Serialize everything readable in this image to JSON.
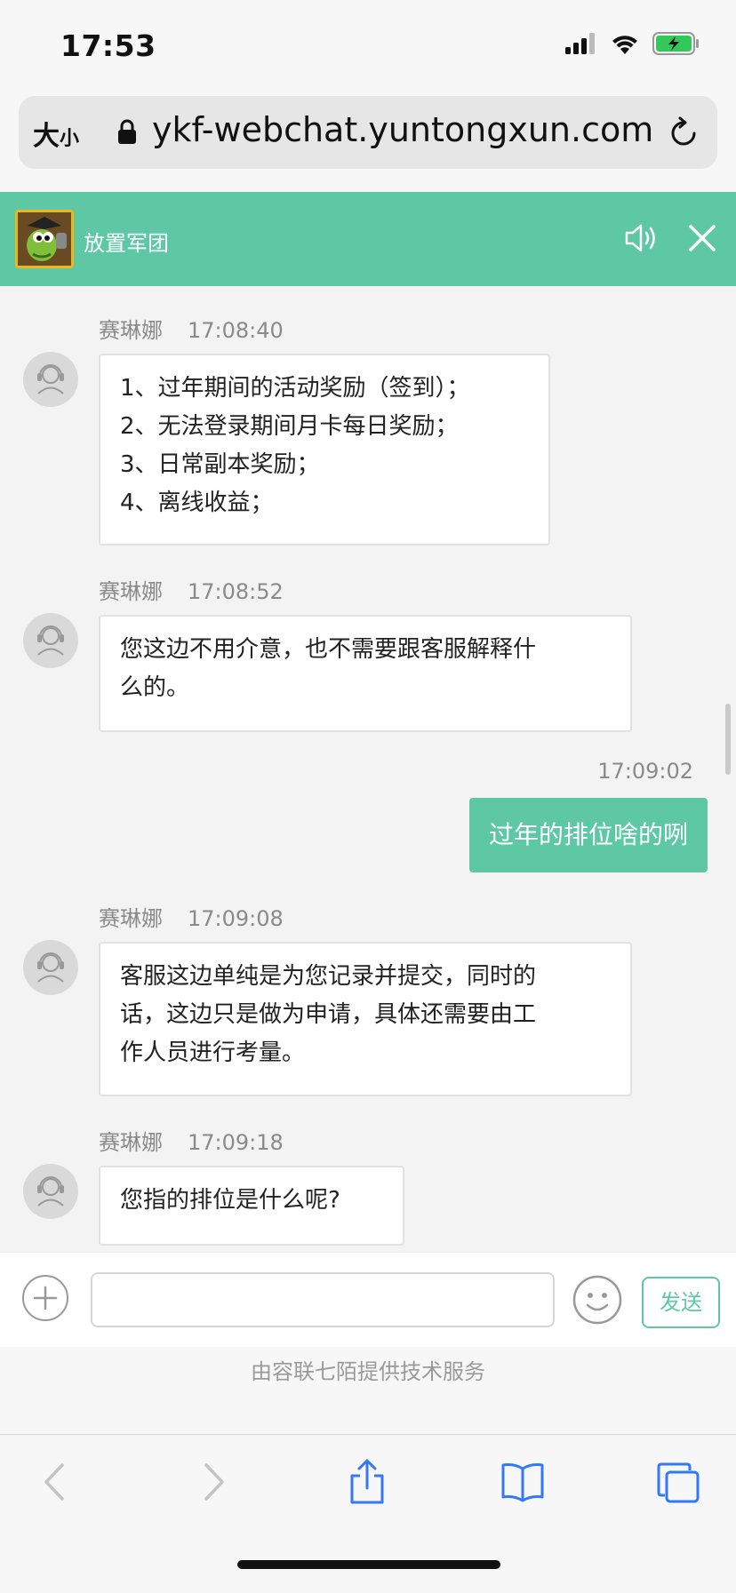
{
  "status_bar": {
    "time": "17:53"
  },
  "browser": {
    "text_size_label": "大",
    "text_size_small": "小",
    "url": "ykf-webchat.yuntongxun.com"
  },
  "chat": {
    "title": "放置军团",
    "messages": [
      {
        "sender": "赛琳娜",
        "time": "17:08:40",
        "lines": [
          "1、过年期间的活动奖励（签到）；",
          "2、无法登录期间月卡每日奖励；",
          "3、日常副本奖励；",
          "4、离线收益；"
        ]
      },
      {
        "sender": "赛琳娜",
        "time": "17:08:52",
        "lines": [
          "您这边不用介意，也不需要跟客服解释什",
          "么的。"
        ]
      },
      {
        "sender": "me",
        "time": "17:09:02",
        "text": "过年的排位啥的咧"
      },
      {
        "sender": "赛琳娜",
        "time": "17:09:08",
        "lines": [
          "客服这边单纯是为您记录并提交，同时的",
          "话，这边只是做为申请，具体还需要由工",
          "作人员进行考量。"
        ]
      },
      {
        "sender": "赛琳娜",
        "time": "17:09:18",
        "lines": [
          "您指的排位是什么呢?"
        ]
      }
    ]
  },
  "input": {
    "placeholder": "",
    "send_label": "发送"
  },
  "footer": {
    "powered_by": "由容联七陌提供技术服务"
  },
  "colors": {
    "accent": "#5ec8a5",
    "safari_blue": "#3478f6"
  }
}
